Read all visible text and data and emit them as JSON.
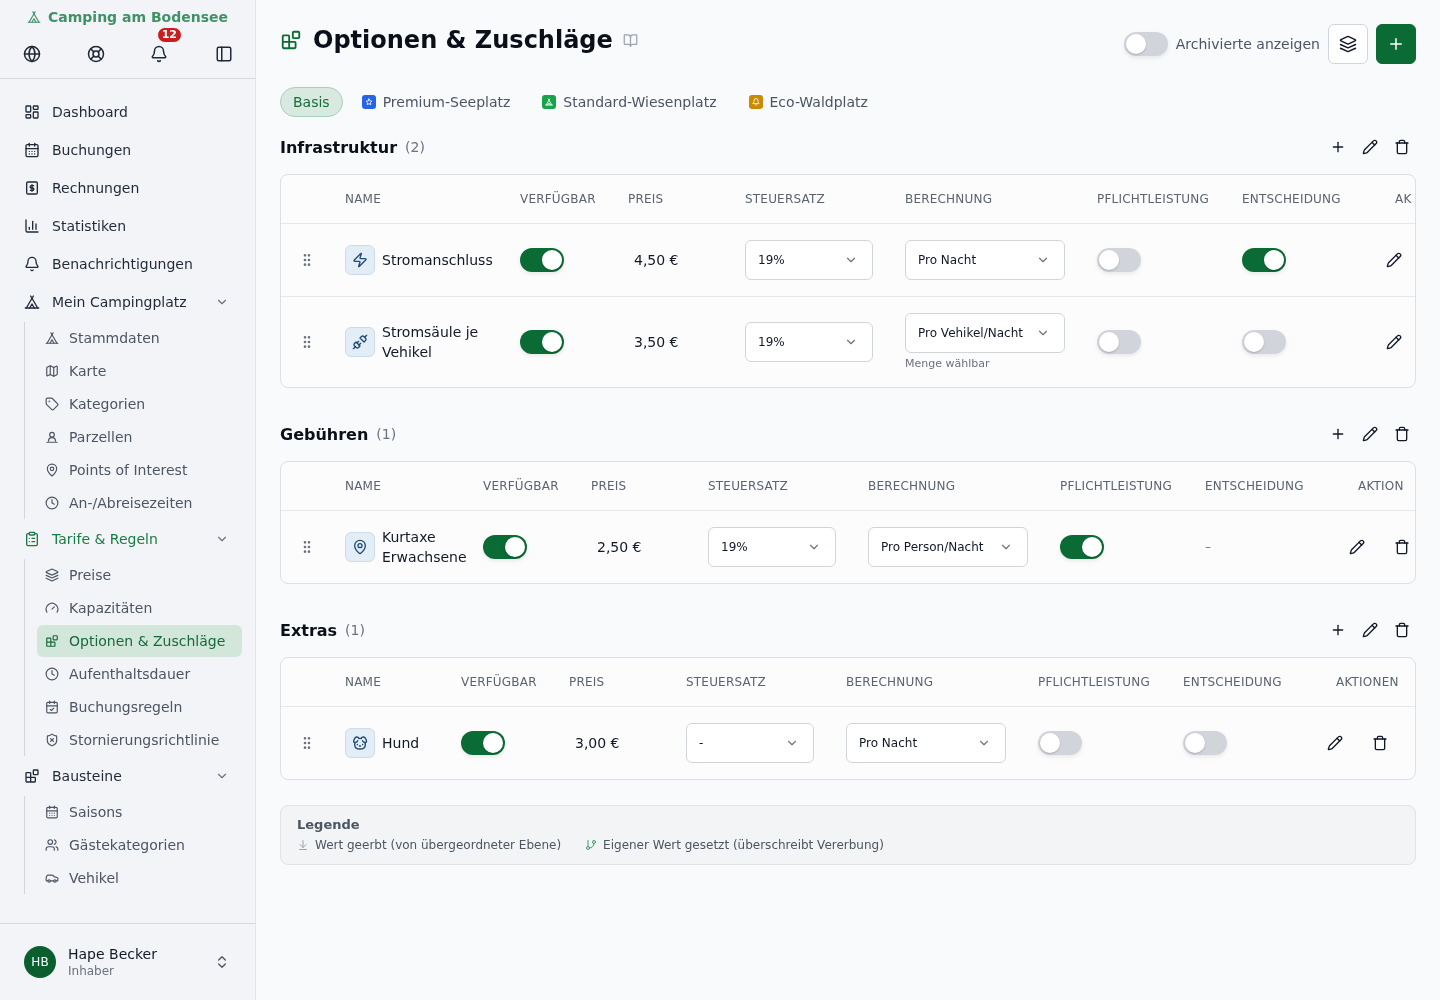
{
  "sidebar": {
    "brand": "Camping am Bodensee",
    "notifications": "12",
    "nav": [
      {
        "label": "Dashboard",
        "selected": false
      },
      {
        "label": "Buchungen",
        "selected": false
      },
      {
        "label": "Rechnungen",
        "selected": false
      },
      {
        "label": "Statistiken",
        "selected": false
      },
      {
        "label": "Benachrichtigungen",
        "selected": false
      },
      {
        "label": "Mein Campingplatz",
        "selected": false,
        "expanded": true,
        "children": [
          {
            "label": "Stammdaten",
            "selected": false
          },
          {
            "label": "Karte",
            "selected": false
          },
          {
            "label": "Kategorien",
            "selected": false
          },
          {
            "label": "Parzellen",
            "selected": false
          },
          {
            "label": "Points of Interest",
            "selected": false
          },
          {
            "label": "An-/Abreisezeiten",
            "selected": false
          }
        ]
      },
      {
        "label": "Tarife & Regeln",
        "selected": false,
        "expanded": true,
        "children": [
          {
            "label": "Preise",
            "selected": false
          },
          {
            "label": "Kapazitäten",
            "selected": false
          },
          {
            "label": "Optionen & Zuschläge",
            "selected": true
          },
          {
            "label": "Aufenthaltsdauer",
            "selected": false
          },
          {
            "label": "Buchungsregeln",
            "selected": false
          },
          {
            "label": "Stornierungsrichtlinie",
            "selected": false
          }
        ]
      },
      {
        "label": "Bausteine",
        "selected": false,
        "expanded": true,
        "children": [
          {
            "label": "Saisons",
            "selected": false
          },
          {
            "label": "Gästekategorien",
            "selected": false
          },
          {
            "label": "Vehikel",
            "selected": false
          }
        ]
      }
    ],
    "user": {
      "initials": "HB",
      "name": "Hape Becker",
      "role": "Inhaber"
    }
  },
  "header": {
    "title": "Optionen & Zuschläge",
    "archived": {
      "label": "Archivierte anzeigen",
      "on": false
    }
  },
  "tabs": [
    {
      "label": "Basis",
      "selected": true
    },
    {
      "label": "Premium-Seeplatz",
      "selected": false,
      "color": "#2563eb"
    },
    {
      "label": "Standard-Wiesenplatz",
      "selected": false,
      "color": "#16a34a"
    },
    {
      "label": "Eco-Waldplatz",
      "selected": false,
      "color": "#ca8a04"
    }
  ],
  "sections": [
    {
      "title": "Infrastruktur",
      "count": "(2)",
      "columns": [
        "NAME",
        "VERFÜGBAR",
        "PREIS",
        "STEUERSATZ",
        "BERECHNUNG",
        "PFLICHTLEISTUNG",
        "ENTSCHEIDUNG",
        "AK"
      ],
      "rows": [
        {
          "name": "Stromanschluss",
          "available": true,
          "price": "4,50 €",
          "tax": "19%",
          "billing": "Pro Nacht",
          "mandatory": false,
          "decision": {
            "kind": "toggle",
            "on": true
          },
          "actions": [
            {
              "kind": "edit"
            }
          ]
        },
        {
          "name": "Stromsäule je Vehikel",
          "available": true,
          "price": "3,50 €",
          "tax": "19%",
          "billing": "Pro Vehikel/Nacht",
          "billing_hint": "Menge wählbar",
          "mandatory": false,
          "decision": {
            "kind": "toggle",
            "on": false
          },
          "actions": [
            {
              "kind": "edit"
            }
          ]
        }
      ]
    },
    {
      "title": "Gebühren",
      "count": "(1)",
      "columns": [
        "NAME",
        "VERFÜGBAR",
        "PREIS",
        "STEUERSATZ",
        "BERECHNUNG",
        "PFLICHTLEISTUNG",
        "ENTSCHEIDUNG",
        "AKTION"
      ],
      "rows": [
        {
          "name": "Kurtaxe Erwachsene",
          "available": true,
          "price": "2,50 €",
          "tax": "19%",
          "billing": "Pro Person/Nacht",
          "mandatory": true,
          "decision": {
            "kind": "text",
            "text": "–"
          },
          "actions": [
            {
              "kind": "edit"
            },
            {
              "kind": "delete"
            }
          ]
        }
      ]
    },
    {
      "title": "Extras",
      "count": "(1)",
      "columns": [
        "NAME",
        "VERFÜGBAR",
        "PREIS",
        "STEUERSATZ",
        "BERECHNUNG",
        "PFLICHTLEISTUNG",
        "ENTSCHEIDUNG",
        "AKTIONEN"
      ],
      "rows": [
        {
          "name": "Hund",
          "available": true,
          "price": "3,00 €",
          "tax": "-",
          "billing": "Pro Nacht",
          "mandatory": false,
          "decision": {
            "kind": "toggle",
            "on": false
          },
          "actions": [
            {
              "kind": "edit"
            },
            {
              "kind": "delete"
            }
          ]
        }
      ]
    }
  ],
  "legend": {
    "title": "Legende",
    "items": [
      {
        "kind": "inherited",
        "text": "Wert geerbt (von übergeordneter Ebene)"
      },
      {
        "kind": "override",
        "text": "Eigener Wert gesetzt (überschreibt Vererbung)"
      }
    ]
  }
}
